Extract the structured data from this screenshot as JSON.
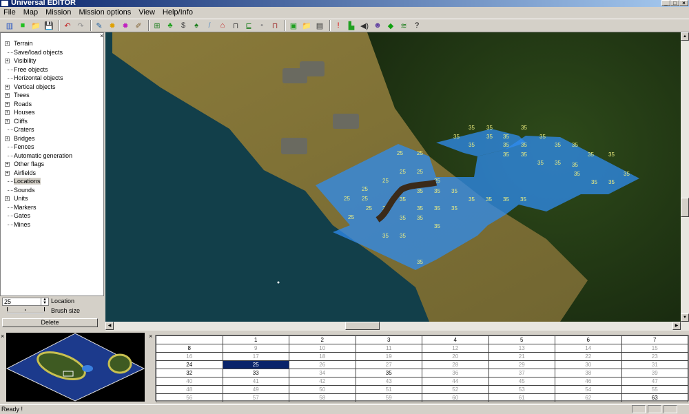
{
  "window": {
    "title": "Universal EDITOR"
  },
  "menu": [
    "File",
    "Map",
    "Mission",
    "Mission options",
    "View",
    "Help/Info"
  ],
  "toolbar_icons": [
    "units-icon",
    "new-icon",
    "open-icon",
    "save-icon",
    "undo-icon",
    "redo-icon",
    "terrain-icon",
    "brush-yellow-icon",
    "brush-pink-icon",
    "edit-icon",
    "objects-icon",
    "trees-icon",
    "vertical-object-icon",
    "palm-icon",
    "road-icon",
    "house-icon",
    "bridge-icon",
    "cliff-icon",
    "light-icon",
    "fence-icon",
    "map-green-icon",
    "folder-icon",
    "save-mission-icon",
    "flag-red-icon",
    "units-place-icon",
    "sound-icon",
    "people-icon",
    "marker-icon",
    "wave-icon",
    "help-icon"
  ],
  "tree": {
    "items": [
      {
        "label": "Terrain",
        "expandable": true
      },
      {
        "label": "Save/load objects",
        "expandable": false
      },
      {
        "label": "Visibility",
        "expandable": true
      },
      {
        "label": "Free objects",
        "expandable": false
      },
      {
        "label": "Horizontal objects",
        "expandable": false
      },
      {
        "label": "Vertical objects",
        "expandable": true
      },
      {
        "label": "Trees",
        "expandable": true
      },
      {
        "label": "Roads",
        "expandable": true
      },
      {
        "label": "Houses",
        "expandable": true
      },
      {
        "label": "Cliffs",
        "expandable": true
      },
      {
        "label": "Craters",
        "expandable": false
      },
      {
        "label": "Bridges",
        "expandable": true
      },
      {
        "label": "Fences",
        "expandable": false
      },
      {
        "label": "Automatic generation",
        "expandable": false
      },
      {
        "label": "Other flags",
        "expandable": true
      },
      {
        "label": "Airfields",
        "expandable": true
      },
      {
        "label": "Locations",
        "expandable": false,
        "selected": true
      },
      {
        "label": "Sounds",
        "expandable": false
      },
      {
        "label": "Units",
        "expandable": true
      },
      {
        "label": "Markers",
        "expandable": false
      },
      {
        "label": "Gates",
        "expandable": false
      },
      {
        "label": "Mines",
        "expandable": false
      }
    ]
  },
  "controls": {
    "location_value": "25",
    "location_label": "Location",
    "brush_label": "Brush size",
    "brush_level": 0,
    "delete_label": "Delete"
  },
  "map": {
    "tiles_25": [
      "25",
      "25",
      "25",
      "25",
      "25",
      "25",
      "25",
      "25",
      "25",
      "25",
      "25",
      "25"
    ],
    "tiles_35": [
      "35",
      "35",
      "35",
      "35",
      "35",
      "35",
      "35",
      "35",
      "35",
      "35",
      "35",
      "35",
      "35",
      "35",
      "35",
      "35",
      "35",
      "35",
      "35",
      "35",
      "35",
      "35",
      "35",
      "35",
      "35",
      "35",
      "35",
      "35",
      "35",
      "35",
      "35",
      "35",
      "35",
      "35",
      "35",
      "35",
      "35",
      "35",
      "35",
      "35"
    ]
  },
  "table": {
    "header": [
      "",
      "1",
      "2",
      "3",
      "4",
      "5",
      "6",
      "7"
    ],
    "rows": [
      [
        "8",
        "9",
        "10",
        "11",
        "12",
        "13",
        "14",
        "15"
      ],
      [
        "16",
        "17",
        "18",
        "19",
        "20",
        "21",
        "22",
        "23"
      ],
      [
        "24",
        "25",
        "26",
        "27",
        "28",
        "29",
        "30",
        "31"
      ],
      [
        "32",
        "33",
        "34",
        "35",
        "36",
        "37",
        "38",
        "39"
      ],
      [
        "40",
        "41",
        "42",
        "43",
        "44",
        "45",
        "46",
        "47"
      ],
      [
        "48",
        "49",
        "50",
        "51",
        "52",
        "53",
        "54",
        "55"
      ],
      [
        "56",
        "57",
        "58",
        "59",
        "60",
        "61",
        "62",
        "63"
      ]
    ],
    "bold": [
      "8",
      "24",
      "32",
      "33",
      "35",
      "63"
    ],
    "selected": "25"
  },
  "status": {
    "text": "Ready !"
  }
}
